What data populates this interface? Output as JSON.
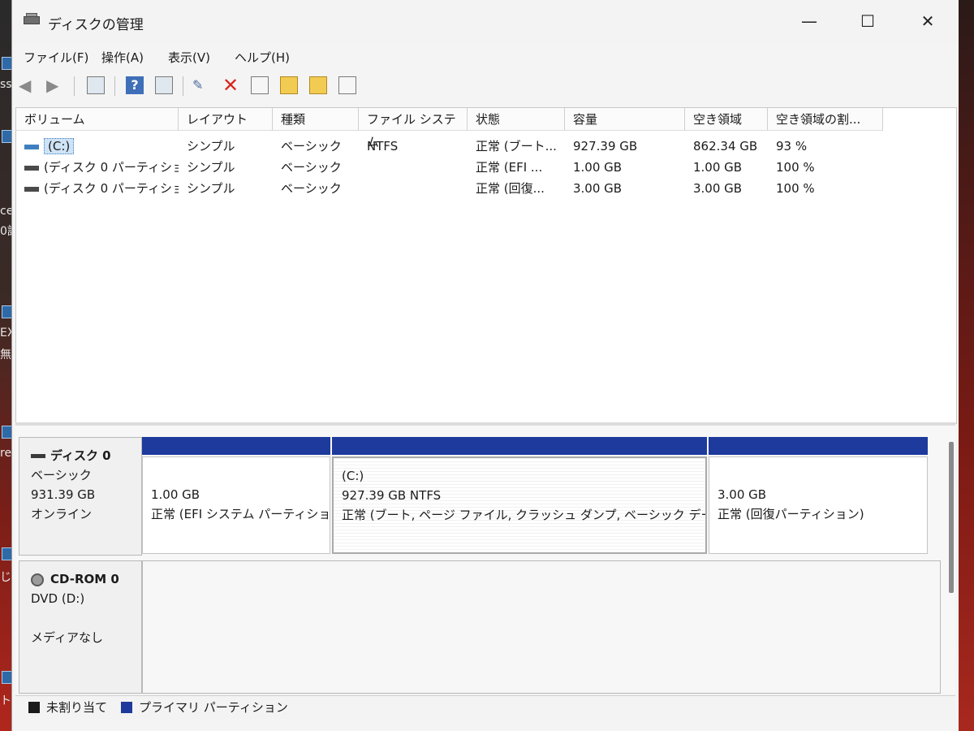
{
  "window": {
    "title": "ディスクの管理",
    "minimize": "—",
    "maximize": "☐",
    "close": "✕"
  },
  "menu": [
    "ファイル(F)",
    "操作(A)",
    "表示(V)",
    "ヘルプ(H)"
  ],
  "toolbar": {
    "back": "back-arrow",
    "forward": "forward-arrow",
    "help_glyph": "?",
    "delete_glyph": "✕"
  },
  "volumes": {
    "columns": [
      "ボリューム",
      "レイアウト",
      "種類",
      "ファイル システム",
      "状態",
      "容量",
      "空き領域",
      "空き領域の割..."
    ],
    "rows": [
      [
        "(C:)",
        "シンプル",
        "ベーシック",
        "NTFS",
        "正常 (ブート...",
        "927.39 GB",
        "862.34 GB",
        "93 %"
      ],
      [
        "(ディスク 0 パーティショ...",
        "シンプル",
        "ベーシック",
        "",
        "正常 (EFI ...",
        "1.00 GB",
        "1.00 GB",
        "100 %"
      ],
      [
        "(ディスク 0 パーティショ...",
        "シンプル",
        "ベーシック",
        "",
        "正常 (回復...",
        "3.00 GB",
        "3.00 GB",
        "100 %"
      ]
    ]
  },
  "disks": [
    {
      "name": "ディスク 0",
      "type": "ベーシック",
      "size": "931.39 GB",
      "status": "オンライン",
      "partitions": [
        {
          "label": "",
          "size": "1.00 GB",
          "status": "正常 (EFI システム パーティショ"
        },
        {
          "label": "(C:)",
          "size": "927.39 GB NTFS",
          "status": "正常 (ブート, ページ ファイル, クラッシュ ダンプ, ベーシック データ パ"
        },
        {
          "label": "",
          "size": "3.00 GB",
          "status": "正常 (回復パーティション)"
        }
      ]
    },
    {
      "name": "CD-ROM 0",
      "type": "DVD (D:)",
      "size": "",
      "status": "メディアなし"
    }
  ],
  "legend": {
    "unallocated": "未割り当て",
    "primary": "プライマリ パーティション",
    "unallocated_color": "#1a1a1a",
    "primary_color": "#1e3a9c"
  },
  "desktop": {
    "labels": [
      "sse",
      "ce",
      "0詳",
      "EX",
      "無",
      "res",
      "じ",
      "ト("
    ]
  }
}
